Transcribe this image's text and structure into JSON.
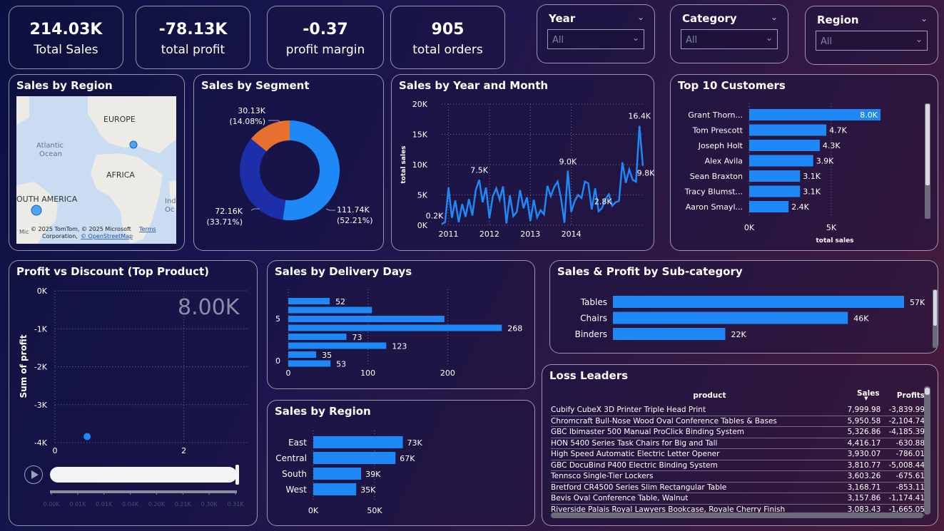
{
  "kpis": [
    {
      "value": "214.03K",
      "label": "Total Sales"
    },
    {
      "value": "-78.13K",
      "label": "total profit"
    },
    {
      "value": "-0.37",
      "label": "profit margin"
    },
    {
      "value": "905",
      "label": "total orders"
    }
  ],
  "slicers": [
    {
      "title": "Year",
      "value": "All"
    },
    {
      "title": "Category",
      "value": "All"
    },
    {
      "title": "Region",
      "value": "All"
    }
  ],
  "map": {
    "title": "Sales by Region",
    "labels": {
      "europe": "EUROPE",
      "africa": "AFRICA",
      "south_america": "OUTH AMERICA",
      "atlantic": "Atlantic",
      "ocean": "Ocean",
      "ind1": "Ind",
      "ind2": "Oc"
    },
    "copyright": "© 2025 TomTom, © 2025 Microsoft",
    "terms": "Terms",
    "corporation": "Corporation,",
    "osm": "© OpenStreetMap",
    "ms": "Mic"
  },
  "segment": {
    "title": "Sales by Segment",
    "chart_data": {
      "type": "pie",
      "donut": true,
      "slices": [
        {
          "value": 111.74,
          "value_label": "111.74K",
          "pct_label": "(52.21%)",
          "color": "#1e88f6"
        },
        {
          "value": 72.16,
          "value_label": "72.16K",
          "pct_label": "(33.71%)",
          "color": "#1c2ea8"
        },
        {
          "value": 30.13,
          "value_label": "30.13K",
          "pct_label": "(14.08%)",
          "color": "#e8702e"
        }
      ]
    }
  },
  "yearmonth": {
    "title": "Sales by Year and Month",
    "chart_data": {
      "type": "line",
      "ylabel": "total sales",
      "yticks": [
        "0K",
        "5K",
        "10K",
        "15K",
        "20K"
      ],
      "ylim": [
        0,
        20000
      ],
      "xticks": [
        "2011",
        "2012",
        "2013",
        "2014"
      ],
      "color": "#1e88f6",
      "values": [
        200,
        500,
        6200,
        1200,
        4100,
        500,
        3500,
        1400,
        4300,
        1600,
        5800,
        7500,
        3800,
        6200,
        1200,
        4800,
        6100,
        4200,
        6400,
        300,
        4900,
        1500,
        2200,
        5800,
        2800,
        4600,
        700,
        4200,
        1300,
        2500,
        1800,
        6500,
        4800,
        6300,
        7200,
        4400,
        400,
        9000,
        2200,
        4000,
        5000,
        4500,
        7200,
        6900,
        2600,
        6100,
        2300,
        2800,
        4300,
        5100,
        3200,
        3800,
        4000,
        10400,
        7000,
        9200,
        7500,
        7200,
        16400,
        9800
      ],
      "annotations": [
        {
          "index": 0,
          "label": "0.2K"
        },
        {
          "index": 11,
          "label": "7.5K"
        },
        {
          "index": 37,
          "label": "9.0K"
        },
        {
          "index": 49,
          "label": "2.8K"
        },
        {
          "index": 58,
          "label": "16.4K"
        },
        {
          "index": 59,
          "label": "9.8K"
        }
      ]
    }
  },
  "customers": {
    "title": "Top 10 Customers",
    "chart_data": {
      "type": "bar",
      "orientation": "horizontal",
      "categories": [
        "Grant Thorn...",
        "Tom Prescott",
        "Joseph Holt",
        "Alex Avila",
        "Sean Braxton",
        "Tracy Blumst...",
        "Aaron Smayl..."
      ],
      "values": [
        8000,
        4700,
        4300,
        3900,
        3100,
        3100,
        2400
      ],
      "value_labels": [
        "8.0K",
        "4.7K",
        "4.3K",
        "3.9K",
        "3.1K",
        "3.1K",
        "2.4K"
      ],
      "xticks": [
        "0K",
        "5K"
      ],
      "xlim": [
        0,
        10000
      ],
      "xlabel": "total sales",
      "color": "#1e88f6"
    }
  },
  "profit_discount": {
    "title": "Profit vs Discount (Top Product)",
    "big_label": "8.00K",
    "chart_data": {
      "type": "scatter",
      "ylabel": "Sum of profit",
      "yticks": [
        "0K",
        "-1K",
        "-2K",
        "-3K",
        "-4K"
      ],
      "ylim": [
        -4000,
        0
      ],
      "xticks": [
        "0",
        "2"
      ],
      "xlim": [
        0,
        3
      ],
      "points": [
        {
          "x": 0.5,
          "y": -3840
        }
      ],
      "color": "#1e88f6"
    },
    "play_axis_labels": [
      "0.00K",
      "0.01K",
      "0.01K",
      "0.04K",
      "0.20K",
      "0.21K",
      "0.30K",
      "0.31K"
    ]
  },
  "delivery": {
    "title": "Sales by Delivery Days",
    "chart_data": {
      "type": "bar",
      "orientation": "horizontal",
      "values": [
        52,
        105,
        196,
        268,
        73,
        123,
        35,
        53
      ],
      "value_labels": [
        "52",
        "",
        "",
        "268",
        "73",
        "123",
        "35",
        "53"
      ],
      "yticks": [
        "5",
        "0"
      ],
      "xticks": [
        "0",
        "100",
        "200"
      ],
      "xlim": [
        0,
        300
      ],
      "color": "#1e88f6"
    }
  },
  "region_bar": {
    "title": "Sales by Region",
    "chart_data": {
      "type": "bar",
      "orientation": "horizontal",
      "categories": [
        "East",
        "Central",
        "South",
        "West"
      ],
      "values": [
        73,
        67,
        39,
        35
      ],
      "value_labels": [
        "73K",
        "67K",
        "39K",
        "35K"
      ],
      "xticks": [
        "0K",
        "50K"
      ],
      "xlim": [
        0,
        100
      ],
      "color": "#1e88f6"
    }
  },
  "subcat": {
    "title": "Sales & Profit by Sub-category",
    "chart_data": {
      "type": "bar",
      "orientation": "horizontal",
      "categories": [
        "Tables",
        "Chairs",
        "Binders"
      ],
      "values": [
        57,
        46,
        22
      ],
      "value_labels": [
        "57K",
        "46K",
        "22K"
      ],
      "color": "#1e88f6"
    }
  },
  "loss": {
    "title": "Loss Leaders",
    "headers": {
      "product": "product",
      "sales": "Sales",
      "profits": "Profits"
    },
    "rows": [
      {
        "product": "Cubify CubeX 3D Printer Triple Head Print",
        "sales": "7,999.98",
        "profit": "-3,839.99"
      },
      {
        "product": "Chromcraft Bull-Nose Wood Oval Conference Tables & Bases",
        "sales": "5,950.58",
        "profit": "-2,104.74"
      },
      {
        "product": "GBC Ibimaster 500 Manual ProClick Binding System",
        "sales": "5,326.86",
        "profit": "-4,185.39"
      },
      {
        "product": "HON 5400 Series Task Chairs for Big and Tall",
        "sales": "4,416.17",
        "profit": "-630.88"
      },
      {
        "product": "High Speed Automatic Electric Letter Opener",
        "sales": "3,930.07",
        "profit": "-786.01"
      },
      {
        "product": "GBC DocuBind P400 Electric Binding System",
        "sales": "3,810.77",
        "profit": "-5,008.44"
      },
      {
        "product": "Tennsco Single-Tier Lockers",
        "sales": "3,603.26",
        "profit": "-675.61"
      },
      {
        "product": "Bretford CR4500 Series Slim Rectangular Table",
        "sales": "3,168.71",
        "profit": "-853.11"
      },
      {
        "product": "Bevis Oval Conference Table, Walnut",
        "sales": "3,157.86",
        "profit": "-1,174.41"
      },
      {
        "product": "Riverside Palais Royal Lawyers Bookcase, Royale Cherry Finish",
        "sales": "3,083.43",
        "profit": "-1,665.05"
      }
    ]
  }
}
